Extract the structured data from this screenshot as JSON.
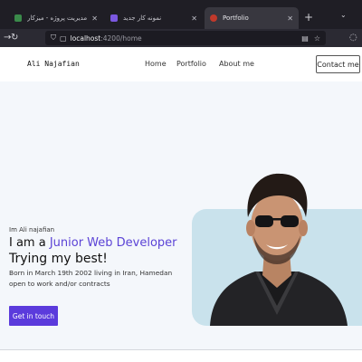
{
  "browser": {
    "tabs": [
      {
        "title": "مدیریت پروژه - میزکار",
        "active": false,
        "favicon_color": "#3a8a4a"
      },
      {
        "title": "نمونه کار جدید",
        "active": false,
        "favicon_color": "#7b58e0"
      },
      {
        "title": "Portfolio",
        "active": true,
        "favicon_color": "#c0392b"
      }
    ],
    "new_tab_icon": "plus-icon",
    "url_host": "localhost",
    "url_rest": ":4200/home"
  },
  "site": {
    "logo": "Ali Najafian",
    "menu": [
      "Home",
      "Portfolio",
      "About me"
    ],
    "contact_button": "Contact me",
    "hero": {
      "intro": "Im Ali najafian",
      "title_prefix": "I am a ",
      "title_highlight": "Junior Web Developer",
      "title_line2": "Trying my best!",
      "description": "Born in March 19th 2002 living in Iran, Hamedan open to work and/or contracts",
      "cta": "Get in touch"
    },
    "accent_color": "#5b3bdc"
  }
}
